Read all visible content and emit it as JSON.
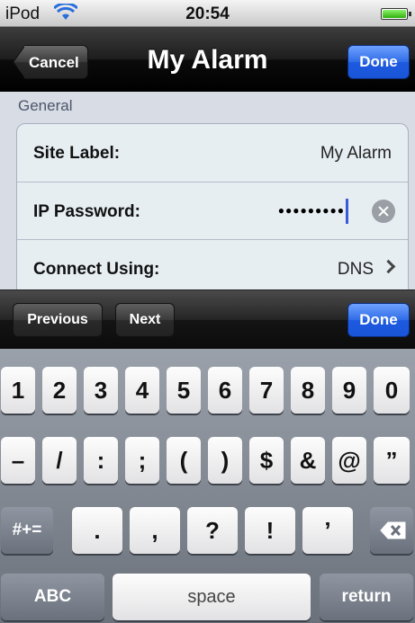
{
  "status_bar": {
    "carrier": "iPod",
    "time": "20:54",
    "wifi_icon": "wifi-icon",
    "battery_icon": "battery-icon",
    "battery_level": 1.0
  },
  "nav": {
    "back_label": "Cancel",
    "title": "My Alarm",
    "done_label": "Done"
  },
  "section": {
    "title": "General"
  },
  "rows": [
    {
      "label": "Site Label:",
      "value": "My Alarm"
    },
    {
      "label": "IP Password:",
      "value": "●●●●●●●●●"
    },
    {
      "label": "Connect Using:",
      "value": "DNS"
    }
  ],
  "accessory": {
    "previous": "Previous",
    "next": "Next",
    "done": "Done"
  },
  "keyboard": {
    "row1": [
      "1",
      "2",
      "3",
      "4",
      "5",
      "6",
      "7",
      "8",
      "9",
      "0"
    ],
    "row2": [
      "–",
      "/",
      ":",
      ";",
      "(",
      ")",
      "$",
      "&",
      "@",
      "”"
    ],
    "row3": [
      ".",
      ",",
      "?",
      "!",
      "’"
    ],
    "symbols_key": "#+=",
    "abc_key": "ABC",
    "space_key": "space",
    "return_key": "return"
  },
  "colors": {
    "accent_blue": "#1c5ae0",
    "group_bg": "#e7eef2",
    "page_bg": "#d7dce5"
  }
}
